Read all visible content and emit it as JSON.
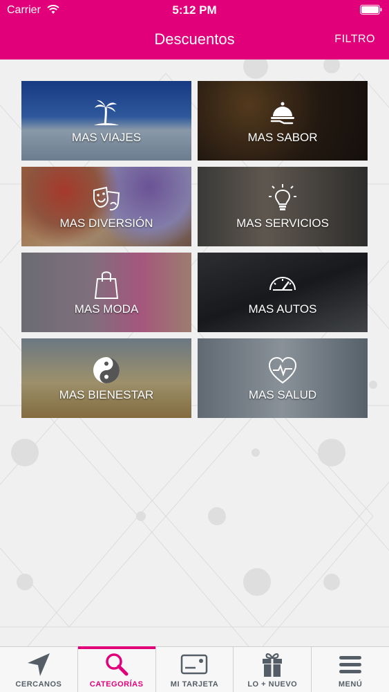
{
  "status_bar": {
    "carrier": "Carrier",
    "time": "5:12 PM"
  },
  "nav": {
    "title": "Descuentos",
    "filter_label": "FILTRO"
  },
  "colors": {
    "brand": "#e2007a",
    "tab_inactive": "#555e66",
    "background": "#f0f0f0"
  },
  "categories": [
    {
      "label": "MAS VIAJES",
      "icon": "palm-tree-icon"
    },
    {
      "label": "MAS SABOR",
      "icon": "cloche-icon"
    },
    {
      "label": "MAS DIVERSIÓN",
      "icon": "theater-masks-icon"
    },
    {
      "label": "MAS SERVICIOS",
      "icon": "lightbulb-icon"
    },
    {
      "label": "MAS MODA",
      "icon": "shopping-bag-icon"
    },
    {
      "label": "MAS AUTOS",
      "icon": "speedometer-icon"
    },
    {
      "label": "MAS BIENESTAR",
      "icon": "yin-yang-icon"
    },
    {
      "label": "MAS SALUD",
      "icon": "heart-pulse-icon"
    }
  ],
  "tabbar": {
    "active": "CATEGORÍAS",
    "items": [
      {
        "label": "CERCANOS",
        "icon": "location-arrow-icon"
      },
      {
        "label": "CATEGORÍAS",
        "icon": "search-icon"
      },
      {
        "label": "MI TARJETA",
        "icon": "card-icon"
      },
      {
        "label": "LO + NUEVO",
        "icon": "gift-icon"
      },
      {
        "label": "MENÚ",
        "icon": "menu-icon"
      }
    ]
  }
}
